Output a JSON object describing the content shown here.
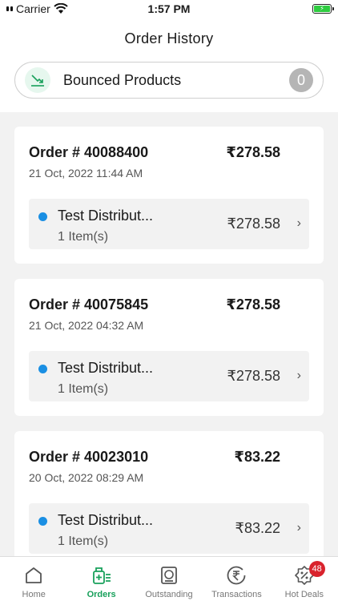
{
  "status_bar": {
    "carrier": "Carrier",
    "time": "1:57 PM"
  },
  "header": {
    "title": "Order History"
  },
  "bounced": {
    "label": "Bounced Products",
    "count": "0"
  },
  "orders": [
    {
      "number": "Order # 40088400",
      "total": "₹278.58",
      "date": "21 Oct, 2022 11:44 AM",
      "distributor": "Test Distribut...",
      "items": "1 Item(s)",
      "amount": "₹278.58"
    },
    {
      "number": "Order # 40075845",
      "total": "₹278.58",
      "date": "21 Oct, 2022 04:32 AM",
      "distributor": "Test Distribut...",
      "items": "1 Item(s)",
      "amount": "₹278.58"
    },
    {
      "number": "Order # 40023010",
      "total": "₹83.22",
      "date": "20 Oct, 2022 08:29 AM",
      "distributor": "Test Distribut...",
      "items": "1 Item(s)",
      "amount": "₹83.22"
    }
  ],
  "tabs": [
    {
      "label": "Home",
      "icon": "home-icon"
    },
    {
      "label": "Orders",
      "icon": "orders-icon",
      "active": true
    },
    {
      "label": "Outstanding",
      "icon": "outstanding-icon"
    },
    {
      "label": "Transactions",
      "icon": "rupee-icon"
    },
    {
      "label": "Hot Deals",
      "icon": "percent-icon",
      "badge": "48"
    }
  ],
  "colors": {
    "accent": "#18a05b",
    "dot": "#1a8fe3",
    "badge": "#d9232d"
  }
}
